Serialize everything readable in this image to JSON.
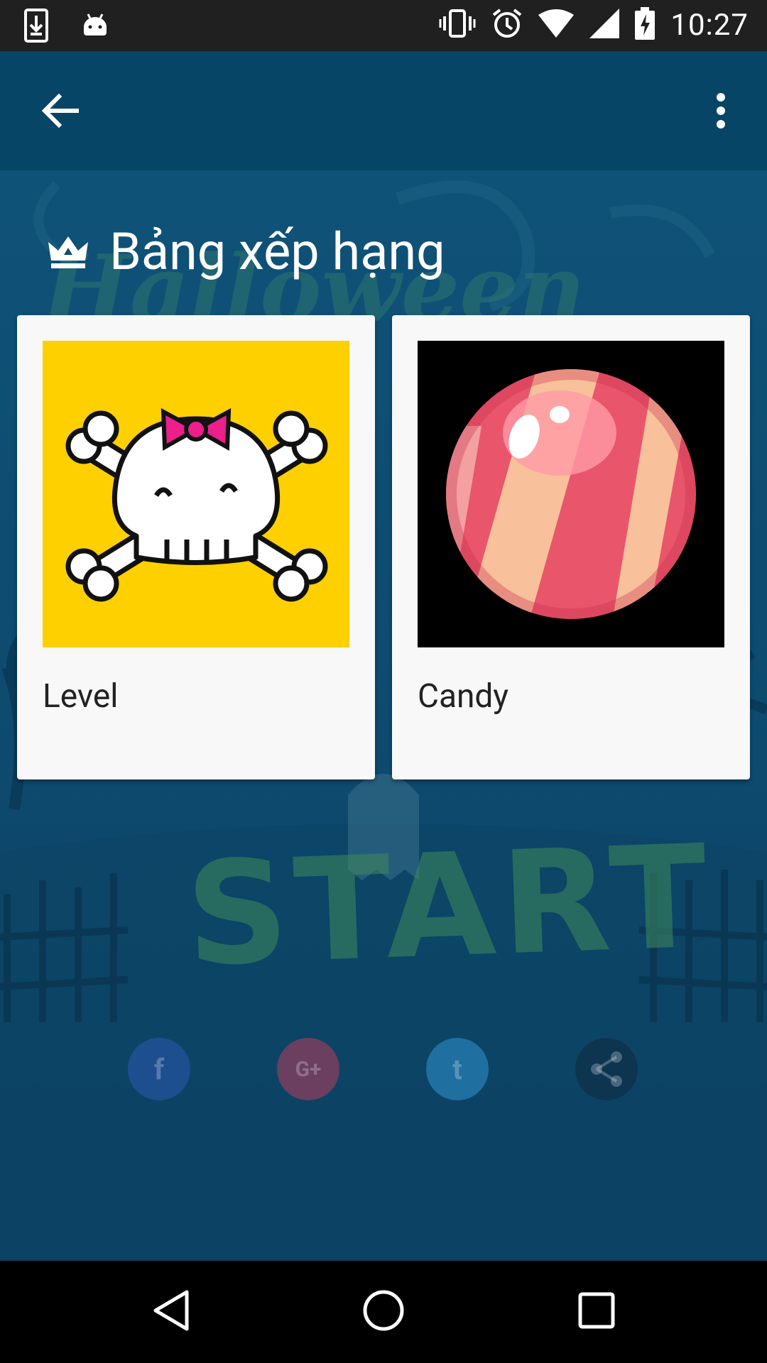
{
  "status_bar": {
    "time": "10:27",
    "left_icons": [
      "download-icon",
      "android-icon"
    ],
    "right_icons": [
      "vibrate-icon",
      "alarm-icon",
      "wifi-icon",
      "signal-icon",
      "battery-charging-icon"
    ]
  },
  "app_bar": {
    "back_icon": "arrow-back-icon",
    "menu_icon": "more-vert-icon",
    "color": "#064566"
  },
  "leaderboard": {
    "title": "Bảng xếp hạng",
    "title_icon": "crown-icon",
    "cards": [
      {
        "label": "Level",
        "image": "skull-crossbones-bow",
        "image_bg": "#ffd000"
      },
      {
        "label": "Candy",
        "image": "striped-candy-ball",
        "image_bg": "#000000"
      }
    ]
  },
  "background": {
    "watermark_words": [
      "Halloween",
      "START"
    ],
    "social_icons": [
      {
        "name": "facebook-icon",
        "glyph": "f",
        "color": "#1d4f8e"
      },
      {
        "name": "google-plus-icon",
        "glyph": "G+",
        "color": "#6a3f5f"
      },
      {
        "name": "twitter-icon",
        "glyph": "t",
        "color": "#1f6fa0"
      },
      {
        "name": "share-icon",
        "glyph": "",
        "color": "#0d3550"
      }
    ]
  },
  "nav_bar": {
    "icons": [
      "nav-back-icon",
      "nav-home-icon",
      "nav-recents-icon"
    ]
  }
}
